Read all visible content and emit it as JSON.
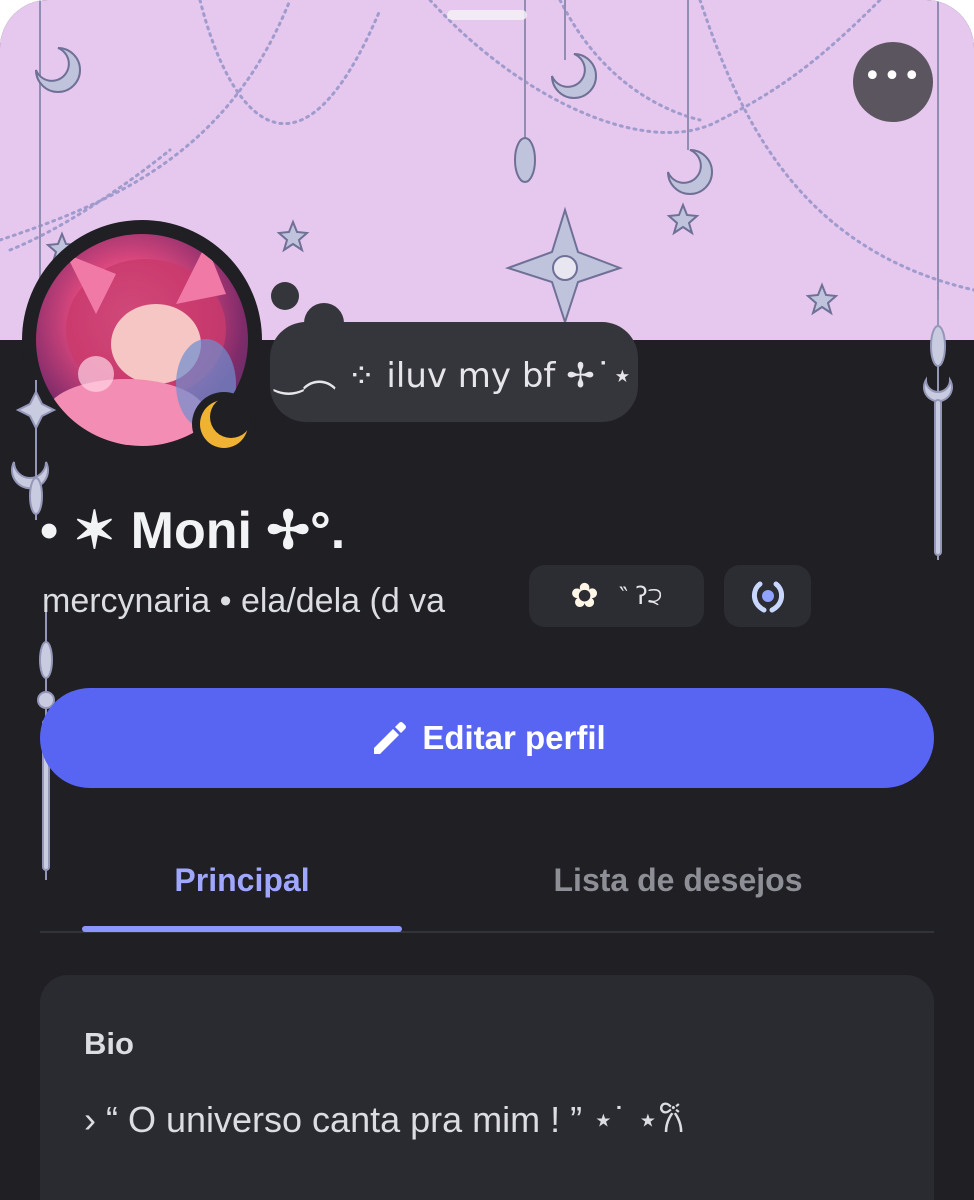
{
  "colors": {
    "banner": "#e6c7ee",
    "background": "#1f1f24",
    "accent": "#5865f2",
    "active_tab": "#9fa7ff",
    "status_idle": "#f0b232"
  },
  "header": {
    "more_icon": "more-horizontal-icon",
    "more_label": "•••"
  },
  "profile": {
    "status_text": "‿︵ ⁘ iluv my bf ✢˙⋆",
    "display_name": "• ✶ Moni ✢°.",
    "username_line": "mercynaria • ela/dela (d va",
    "tag_text": "‶ ʔ੨",
    "tag_icon": "flower-icon",
    "badge_icon": "laurel-badge-icon",
    "avatar_status": "idle"
  },
  "actions": {
    "edit_label": "Editar perfil",
    "edit_icon": "pencil-icon"
  },
  "tabs": [
    {
      "label": "Principal",
      "active": true
    },
    {
      "label": "Lista de desejos",
      "active": false
    }
  ],
  "bio": {
    "title": "Bio",
    "text": "› “ O universo canta pra mim ! ” ⋆˙ ⋆𐙚"
  }
}
